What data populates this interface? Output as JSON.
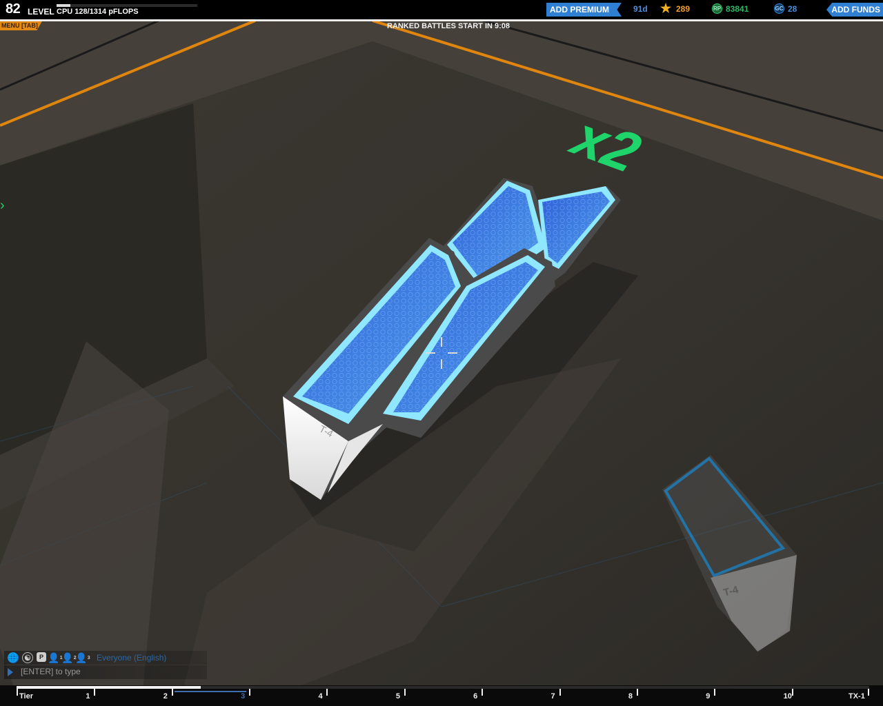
{
  "hud": {
    "level_number": "82",
    "level_label": "LEVEL",
    "cpu_text": "CPU 128/1314 pFLOPS",
    "cpu_fraction": 0.097,
    "menu_label": "MENU [TAB]",
    "ranked_text": "RANKED BATTLES START IN 9:08",
    "premium_label": "ADD PREMIUM",
    "premium_days": "91d",
    "stars": "289",
    "rp": "83841",
    "gc": "28",
    "funds_label": "ADD FUNDS",
    "icons": [
      "star-icon",
      "robit-points-icon",
      "galaxy-coins-icon"
    ]
  },
  "scene": {
    "floor_marker": "x2",
    "block_label_main": "T-4",
    "block_label_ghost": "T-4",
    "colors": {
      "floor": "#3a3630",
      "wall": "#2a2824",
      "stripe": "#e0860f",
      "panel_blue": "#3a7fe0",
      "panel_glow": "#8fe8ff",
      "marker_green": "#1fd46a"
    }
  },
  "chat": {
    "icons": [
      "globe-icon",
      "accessibility-icon",
      "party-icon",
      "team-1-icon",
      "team-2-icon",
      "team-3-icon"
    ],
    "p_label": "P",
    "team_labels": [
      "1",
      "2",
      "3"
    ],
    "channel": "Everyone (English)",
    "input_placeholder": "[ENTER] to type"
  },
  "tiers": {
    "labels": [
      "Tier",
      "1",
      "2",
      "3",
      "4",
      "5",
      "6",
      "7",
      "8",
      "9",
      "10",
      "TX-1"
    ],
    "current_index": 3,
    "progress_fraction": 0.216
  }
}
